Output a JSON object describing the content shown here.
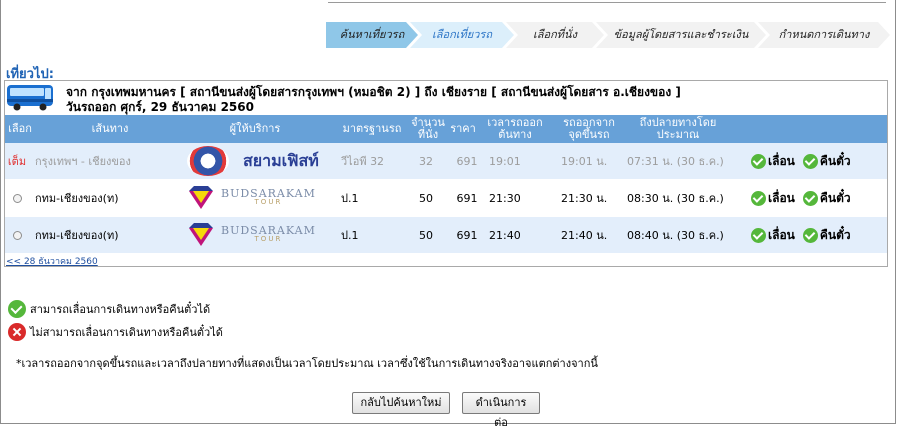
{
  "steps": [
    "ค้นหาเที่ยวรถ",
    "เลือกเที่ยวรถ",
    "เลือกที่นั่ง",
    "ข้อมูลผู้โดยสารและชำระเงิน",
    "กำหนดการเดินทาง"
  ],
  "trip": {
    "title": "เที่ยวไป:",
    "route": "จาก กรุงเทพมหานคร [ สถานีขนส่งผู้โดยสารกรุงเทพฯ (หมอชิต 2) ] ถึง เชียงราย [ สถานีขนส่งผู้โดยสาร อ.เชียงของ ]",
    "date": "วันรถออก ศุกร์, 29 ธันวาคม 2560"
  },
  "table": {
    "headers": {
      "select": "เลือก",
      "route": "เส้นทาง",
      "operator": "ผู้ให้บริการ",
      "standard": "มาตรฐานรถ",
      "seats": "จำนวนที่นั่ง",
      "price": "ราคา",
      "depart": "เวลารถออกต้นทาง",
      "from": "รถออกจากจุดขึ้นรถ",
      "arrive": "ถึงปลายทางโดยประมาณ"
    },
    "rows": [
      {
        "select": "เต็ม",
        "route": "กรุงเทพฯ - เชียงของ",
        "operator": "สยามเฟิสท์",
        "standard": "วีไอพี 32",
        "seats": "32",
        "price": "691",
        "depart": "19:01",
        "from": "19:01 น.",
        "arrive": "07:31 น. (30 ธ.ค.)",
        "change": "เลื่อน",
        "refund": "คืนตั๋ว"
      },
      {
        "select": "",
        "route": "กทม-เชียงของ(ท)",
        "operator": "BUDSARAKAM",
        "operator_sub": "TOUR",
        "standard": "ป.1",
        "seats": "50",
        "price": "691",
        "depart": "21:30",
        "from": "21:30 น.",
        "arrive": "08:30 น. (30 ธ.ค.)",
        "change": "เลื่อน",
        "refund": "คืนตั๋ว"
      },
      {
        "select": "",
        "route": "กทม-เชียงของ(ท)",
        "operator": "BUDSARAKAM",
        "operator_sub": "TOUR",
        "standard": "ป.1",
        "seats": "50",
        "price": "691",
        "depart": "21:40",
        "from": "21:40 น.",
        "arrive": "08:40 น. (30 ธ.ค.)",
        "change": "เลื่อน",
        "refund": "คืนตั๋ว"
      }
    ]
  },
  "pager": {
    "prev": "<< 28 ธันวาคม 2560"
  },
  "legend": {
    "can": "สามารถเลื่อนการเดินทางหรือคืนตั๋วได้",
    "cannot": "ไม่สามารถเลื่อนการเดินทางหรือคืนตั๋วได้"
  },
  "note": "*เวลารถออกจากจุดขึ้นรถและเวลาถึงปลายทางที่แสดงเป็นเวลาโดยประมาณ เวลาซึ่งใช้ในการเดินทางจริงอาจแตกต่างจากนี้",
  "buttons": {
    "back": "กลับไปค้นหาใหม่",
    "next": "ดำเนินการต่อ"
  },
  "colors": {
    "header": "#67a1d8",
    "row_alt": "#e3eefb",
    "step_active": "#8fc7e8",
    "title": "#1f63b5",
    "full": "#e03030"
  }
}
